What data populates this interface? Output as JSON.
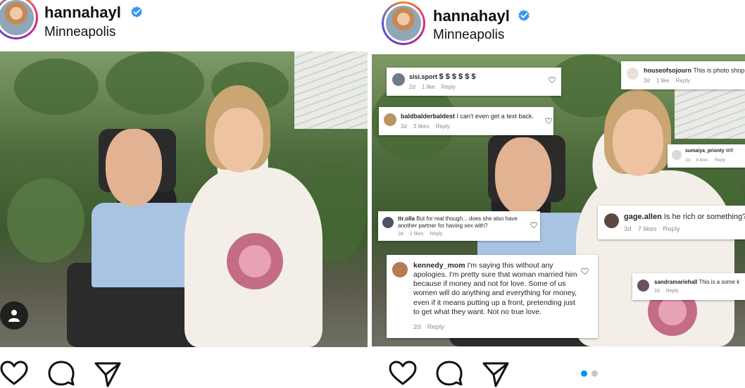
{
  "posts": [
    {
      "username": "hannahayl",
      "location": "Minneapolis"
    },
    {
      "username": "hannahayl",
      "location": "Minneapolis"
    }
  ],
  "colors": {
    "verified_blue": "#3897f0",
    "dot_active": "#0095f6",
    "dot_inactive": "#c7c7c7"
  },
  "icons": {
    "like": "heart-icon",
    "comment": "comment-icon",
    "share": "send-icon",
    "user_tag": "person-icon"
  },
  "comments": [
    {
      "user": "sisi.sport",
      "text": "$ $ $ $ $ $",
      "age": "2d",
      "likes": "1 like",
      "reply": "Reply"
    },
    {
      "user": "baldbalderbaldest",
      "text": "I can't even get a text back.",
      "age": "3d",
      "likes": "3 likes",
      "reply": "Reply"
    },
    {
      "user": "ttr.olla",
      "text": "But for real though... does she also have another partner for having sex with?",
      "age": "2d",
      "likes": "2 likes",
      "reply": "Reply"
    },
    {
      "user": "kennedy_mom",
      "text": "I'm saying this without any apologies. I'm pretty sure that woman married him because if money and not for love. Some of us women will do anything and everything for money, even if it means putting up a front, pretending just to get what they want. Not no true love.",
      "age": "2d",
      "likes": "",
      "reply": "Reply"
    },
    {
      "user": "houseofsojourn",
      "text": "This is photo shop",
      "age": "3d",
      "likes": "1 like",
      "reply": "Reply"
    },
    {
      "user": "sumaiya_prionty",
      "text": "Wtf",
      "age": "2d",
      "likes": "8 likes",
      "reply": "Reply"
    },
    {
      "user": "gage.allen",
      "text": "Is he rich or something?",
      "age": "3d",
      "likes": "7 likes",
      "reply": "Reply"
    },
    {
      "user": "sandramariehall",
      "text": "This is a some k",
      "age": "2d",
      "likes": "",
      "reply": "Reply"
    }
  ]
}
